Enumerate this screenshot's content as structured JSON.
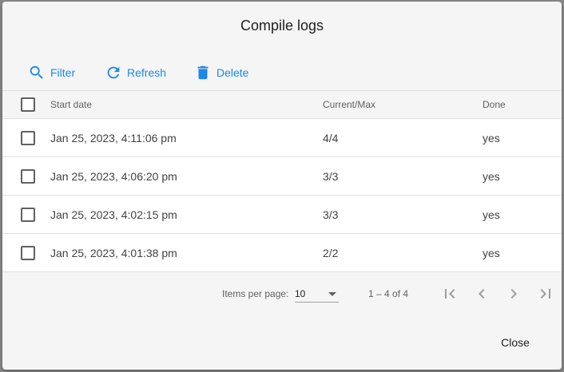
{
  "dialog": {
    "title": "Compile logs"
  },
  "toolbar": {
    "filter": {
      "label": "Filter",
      "icon": "search-icon"
    },
    "refresh": {
      "label": "Refresh",
      "icon": "refresh-icon"
    },
    "delete": {
      "label": "Delete",
      "icon": "trash-icon"
    }
  },
  "table": {
    "headers": {
      "start_date": "Start date",
      "current_max": "Current/Max",
      "done": "Done"
    },
    "rows": [
      {
        "start_date": "Jan 25, 2023, 4:11:06 pm",
        "current_max": "4/4",
        "done": "yes"
      },
      {
        "start_date": "Jan 25, 2023, 4:06:20 pm",
        "current_max": "3/3",
        "done": "yes"
      },
      {
        "start_date": "Jan 25, 2023, 4:02:15 pm",
        "current_max": "3/3",
        "done": "yes"
      },
      {
        "start_date": "Jan 25, 2023, 4:01:38 pm",
        "current_max": "2/2",
        "done": "yes"
      }
    ]
  },
  "paginator": {
    "items_per_page_label": "Items per page:",
    "items_per_page_value": "10",
    "range_label": "1 – 4 of 4"
  },
  "actions": {
    "close": "Close"
  },
  "colors": {
    "accent": "#1e88e5"
  }
}
